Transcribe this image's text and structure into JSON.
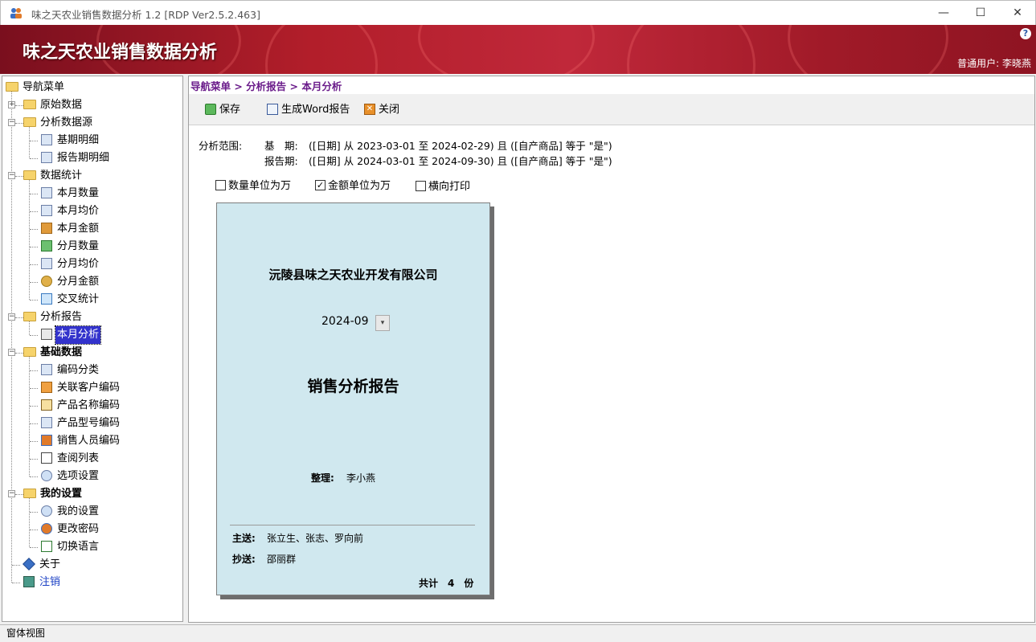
{
  "window": {
    "title": "味之天农业销售数据分析 1.2 [RDP Ver2.5.2.463]",
    "minimize": "—",
    "maximize": "☐",
    "close": "✕"
  },
  "banner": {
    "title": "味之天农业销售数据分析",
    "help": "?",
    "user": "普通用户: 李晓燕"
  },
  "nav": {
    "root": "导航菜单",
    "groups": [
      {
        "label": "原始数据",
        "items": []
      },
      {
        "label": "分析数据源",
        "items": [
          "基期明细",
          "报告期明细"
        ]
      },
      {
        "label": "数据统计",
        "items": [
          "本月数量",
          "本月均价",
          "本月金额",
          "分月数量",
          "分月均价",
          "分月金额",
          "交叉统计"
        ]
      },
      {
        "label": "分析报告",
        "items": [
          "本月分析"
        ]
      },
      {
        "label": "基础数据",
        "items": [
          "编码分类",
          "关联客户编码",
          "产品名称编码",
          "产品型号编码",
          "销售人员编码",
          "查阅列表",
          "选项设置"
        ]
      },
      {
        "label": "我的设置",
        "items": [
          "我的设置",
          "更改密码",
          "切换语言"
        ]
      }
    ],
    "about": "关于",
    "logout": "注销"
  },
  "breadcrumb": "导航菜单 > 分析报告 > 本月分析",
  "toolbar": {
    "save": "保存",
    "word": "生成Word报告",
    "close": "关闭"
  },
  "scope": {
    "label": "分析范围:",
    "base_label": "基　期:",
    "base_value": "([日期] 从 2023-03-01 至 2024-02-29) 且 ([自产商品] 等于 \"是\")",
    "report_label": "报告期:",
    "report_value": "([日期] 从 2024-03-01 至 2024-09-30) 且 ([自产商品] 等于 \"是\")"
  },
  "options": {
    "qty_wan": {
      "label": "数量单位为万",
      "checked": false
    },
    "amt_wan": {
      "label": "金额单位为万",
      "checked": true
    },
    "landscape": {
      "label": "横向打印",
      "checked": false
    }
  },
  "report": {
    "company": "沅陵县味之天农业开发有限公司",
    "period": "2024-09",
    "title": "销售分析报告",
    "compiler_label": "整理:",
    "compiler": "李小燕",
    "to_label": "主送:",
    "to": "张立生、张志、罗向前",
    "cc_label": "抄送:",
    "cc": "邵丽群",
    "copies": "共计　4　份"
  },
  "status": "窗体视图",
  "colors": {
    "banner": "#b21e2a",
    "report_bg": "#d0e8ef",
    "breadcrumb": "#6a1b8a",
    "selection": "#3333cc"
  }
}
